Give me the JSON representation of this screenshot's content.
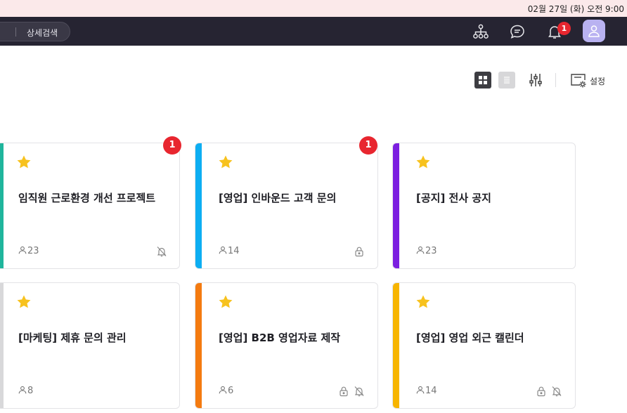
{
  "os": {
    "clock": "02월 27일 (화) 오전 9:00"
  },
  "header": {
    "search_detail_label": "상세검색",
    "icons": [
      "org-chart-icon",
      "chat-icon",
      "bell-icon",
      "avatar-user-icon"
    ],
    "notification_count": "1",
    "avatar_color": "#b9b2f1"
  },
  "toolbar": {
    "view_modes": [
      "grid-view",
      "list-view"
    ],
    "active_view": "grid-view",
    "settings_label": "설정"
  },
  "cards": [
    {
      "title": "임직원 근로환경 개선 프로젝트",
      "members": "23",
      "accent": "#1fb59c",
      "starred": true,
      "badge": "1",
      "status_icons": [
        "bell-off-icon"
      ]
    },
    {
      "title": "[영업] 인바운드 고객 문의",
      "members": "14",
      "accent": "#0daef2",
      "starred": true,
      "badge": "1",
      "status_icons": [
        "lock-icon"
      ]
    },
    {
      "title": "[공지] 전사 공지",
      "members": "23",
      "accent": "#7c1fe0",
      "starred": true,
      "badge": "",
      "status_icons": []
    },
    {
      "title": "[마케팅] 제휴 문의 관리",
      "members": "8",
      "accent": "#d8d8da",
      "starred": true,
      "badge": "",
      "status_icons": []
    },
    {
      "title": "[영업] B2B 영업자료 제작",
      "members": "6",
      "accent": "#f47b10",
      "starred": true,
      "badge": "",
      "status_icons": [
        "lock-icon",
        "bell-off-icon"
      ]
    },
    {
      "title": "[영업] 영업 외근 캘린더",
      "members": "14",
      "accent": "#f7b500",
      "starred": true,
      "badge": "",
      "status_icons": [
        "lock-icon",
        "bell-off-icon"
      ]
    }
  ],
  "colors": {
    "header_bg": "#262432",
    "badge_red": "#e8262f",
    "star_yellow": "#f7c21e"
  }
}
